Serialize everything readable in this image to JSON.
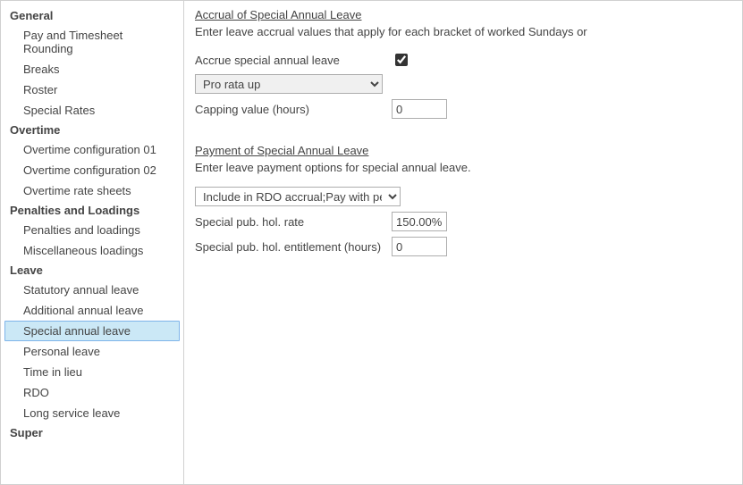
{
  "sidebar": {
    "sections": [
      {
        "title": "General",
        "items": [
          {
            "label": "Pay and Timesheet Rounding"
          },
          {
            "label": "Breaks"
          },
          {
            "label": "Roster"
          },
          {
            "label": "Special Rates"
          }
        ]
      },
      {
        "title": "Overtime",
        "items": [
          {
            "label": "Overtime configuration 01"
          },
          {
            "label": "Overtime configuration 02"
          },
          {
            "label": "Overtime rate sheets"
          }
        ]
      },
      {
        "title": "Penalties and Loadings",
        "items": [
          {
            "label": "Penalties and loadings"
          },
          {
            "label": "Miscellaneous loadings"
          }
        ]
      },
      {
        "title": "Leave",
        "items": [
          {
            "label": "Statutory annual leave"
          },
          {
            "label": "Additional annual leave"
          },
          {
            "label": "Special annual leave",
            "selected": true
          },
          {
            "label": "Personal leave"
          },
          {
            "label": "Time in lieu"
          },
          {
            "label": "RDO"
          },
          {
            "label": "Long service leave"
          }
        ]
      },
      {
        "title": "Super",
        "items": []
      }
    ]
  },
  "main": {
    "accrual": {
      "title": "Accrual of Special Annual Leave",
      "desc": "Enter leave accrual values that apply for each bracket of worked Sundays or",
      "accrue_label": "Accrue special annual leave",
      "accrue_checked": true,
      "method_value": "Pro rata up",
      "capping_label": "Capping value (hours)",
      "capping_value": "0"
    },
    "payment": {
      "title": "Payment of Special Annual Leave",
      "desc": "Enter leave payment options for special annual leave.",
      "options_value": "Include in RDO accrual;Pay with penalties",
      "rate_label": "Special pub. hol. rate",
      "rate_value": "150.00%",
      "entitlement_label": "Special pub. hol. entitlement (hours)",
      "entitlement_value": "0"
    }
  }
}
